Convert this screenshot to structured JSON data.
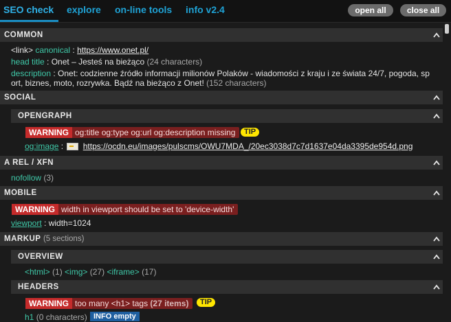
{
  "tabs": [
    {
      "label": "SEO check",
      "active": true
    },
    {
      "label": "explore",
      "active": false
    },
    {
      "label": "on-line tools",
      "active": false
    },
    {
      "label": "info v2.4",
      "active": false
    }
  ],
  "buttons": {
    "open_all": "open all",
    "close_all": "close all"
  },
  "common": {
    "title": "COMMON",
    "canonical_prefix": "<link>",
    "canonical_key": "canonical",
    "canonical_url": "https://www.onet.pl/",
    "head_title_key": "head title",
    "head_title_value": "Onet – Jesteś na bieżąco",
    "head_title_count": "(24 characters)",
    "description_key": "description",
    "description_line1": "Onet: codzienne źródło informacji milionów Polaków - wiadomości z kraju i ze świata 24/7, pogoda, sp",
    "description_line2": "ort, biznes, moto, rozrywka. Bądź na bieżąco z Onet!",
    "description_count": "(152 characters)"
  },
  "social": {
    "title": "SOCIAL",
    "opengraph": {
      "title": "OPENGRAPH",
      "warning_label": "WARNING",
      "warning_text": "og:title og:type og:url og:description missing",
      "tip": "TIP",
      "og_image_key": "og:image",
      "og_image_url": "https://ocdn.eu/images/pulscms/OWU7MDA_/20ec3038d7c7d1637e04da3395de954d.png"
    }
  },
  "arel": {
    "title": "A REL / XFN",
    "nofollow_key": "nofollow",
    "nofollow_count": "(3)"
  },
  "mobile": {
    "title": "MOBILE",
    "warning_label": "WARNING",
    "warning_text": "width in viewport should be set to 'device-width'",
    "viewport_key": "viewport",
    "viewport_value": "width=1024"
  },
  "markup": {
    "title": "MARKUP",
    "count": "(5 sections)",
    "overview": {
      "title": "OVERVIEW",
      "html_tag": "<html>",
      "html_count": "(1)",
      "img_tag": "<img>",
      "img_count": "(27)",
      "iframe_tag": "<iframe>",
      "iframe_count": "(17)"
    },
    "headers": {
      "title": "HEADERS",
      "warning_label": "WARNING",
      "warning_text": "too many <h1> tags",
      "warning_count": "(27 items)",
      "tip": "TIP",
      "h1_key": "h1",
      "h1_count": "(0 characters)",
      "info_label": "INFO empty"
    }
  },
  "colors": {
    "accent_tab": "#2fb2e8",
    "key_green": "#3fc8a8",
    "warning_red": "#c52b2b",
    "tip_yellow": "#ffe600",
    "info_blue": "#1f5fa0"
  }
}
